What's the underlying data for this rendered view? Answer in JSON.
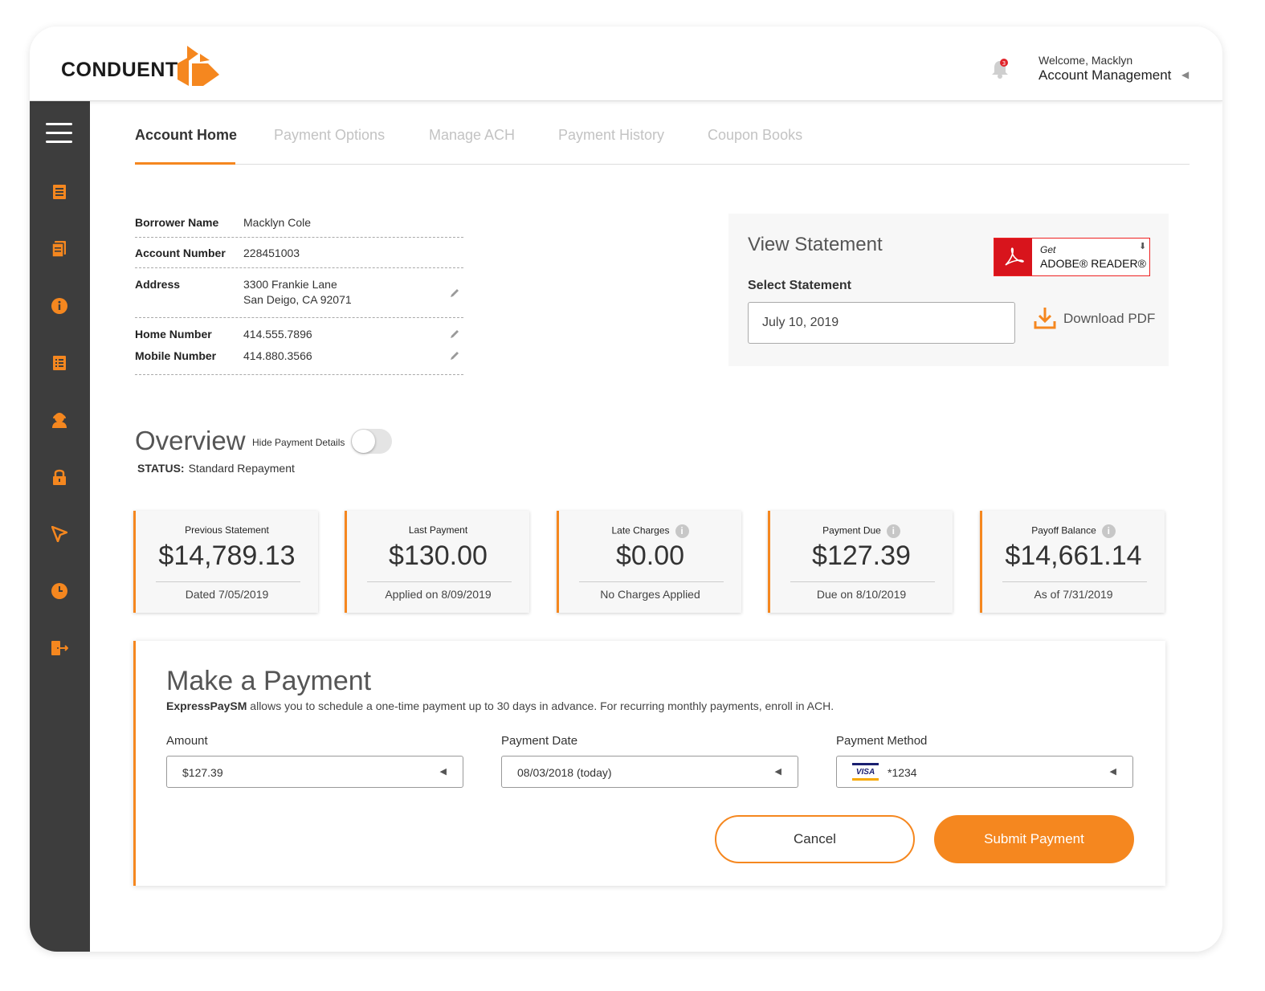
{
  "brand": {
    "name": "CONDUENT",
    "accent": "#f5871f",
    "sidebar_bg": "#3d3d3d"
  },
  "header": {
    "notification_count": "3",
    "welcome": "Welcome, Macklyn",
    "account_menu": "Account Management"
  },
  "sidebar": {
    "icons": [
      "list-icon",
      "document-icon",
      "info-icon",
      "checklist-icon",
      "support-agent-icon",
      "lock-icon",
      "send-icon",
      "clock-icon",
      "logout-icon"
    ]
  },
  "tabs": [
    "Account Home",
    "Payment Options",
    "Manage ACH",
    "Payment History",
    "Coupon Books"
  ],
  "borrower": {
    "name_label": "Borrower Name",
    "name": "Macklyn Cole",
    "account_label": "Account Number",
    "account": "228451003",
    "address_label": "Address",
    "address_line1": "3300 Frankie Lane",
    "address_line2": "San Deigo, CA 92071",
    "home_label": "Home Number",
    "home": "414.555.7896",
    "mobile_label": "Mobile Number",
    "mobile": "414.880.3566"
  },
  "statement": {
    "title": "View Statement",
    "adobe_get": "Get",
    "adobe_name": "ADOBE® READER®",
    "select_label": "Select Statement",
    "selected": "July 10, 2019",
    "download": "Download PDF"
  },
  "overview": {
    "title": "Overview",
    "hide_label": "Hide Payment Details",
    "status_label": "STATUS:",
    "status": "Standard Repayment"
  },
  "cards": [
    {
      "title": "Previous Statement",
      "value": "$14,789.13",
      "foot": "Dated 7/05/2019",
      "info": false
    },
    {
      "title": "Last Payment",
      "value": "$130.00",
      "foot": "Applied on 8/09/2019",
      "info": false
    },
    {
      "title": "Late Charges",
      "value": "$0.00",
      "foot": "No Charges Applied",
      "info": true
    },
    {
      "title": "Payment Due",
      "value": "$127.39",
      "foot": "Due on 8/10/2019",
      "info": true
    },
    {
      "title": "Payoff Balance",
      "value": "$14,661.14",
      "foot": "As of 7/31/2019",
      "info": true
    }
  ],
  "payment": {
    "title": "Make a Payment",
    "brand": "ExpressPaySM",
    "description": "allows you to schedule a one-time payment up to 30 days in advance. For recurring monthly payments, enroll in ACH.",
    "amount_label": "Amount",
    "amount": "$127.39",
    "date_label": "Payment Date",
    "date": "08/03/2018 (today)",
    "method_label": "Payment Method",
    "card_brand": "VISA",
    "method": "*1234",
    "cancel": "Cancel",
    "submit": "Submit Payment"
  }
}
